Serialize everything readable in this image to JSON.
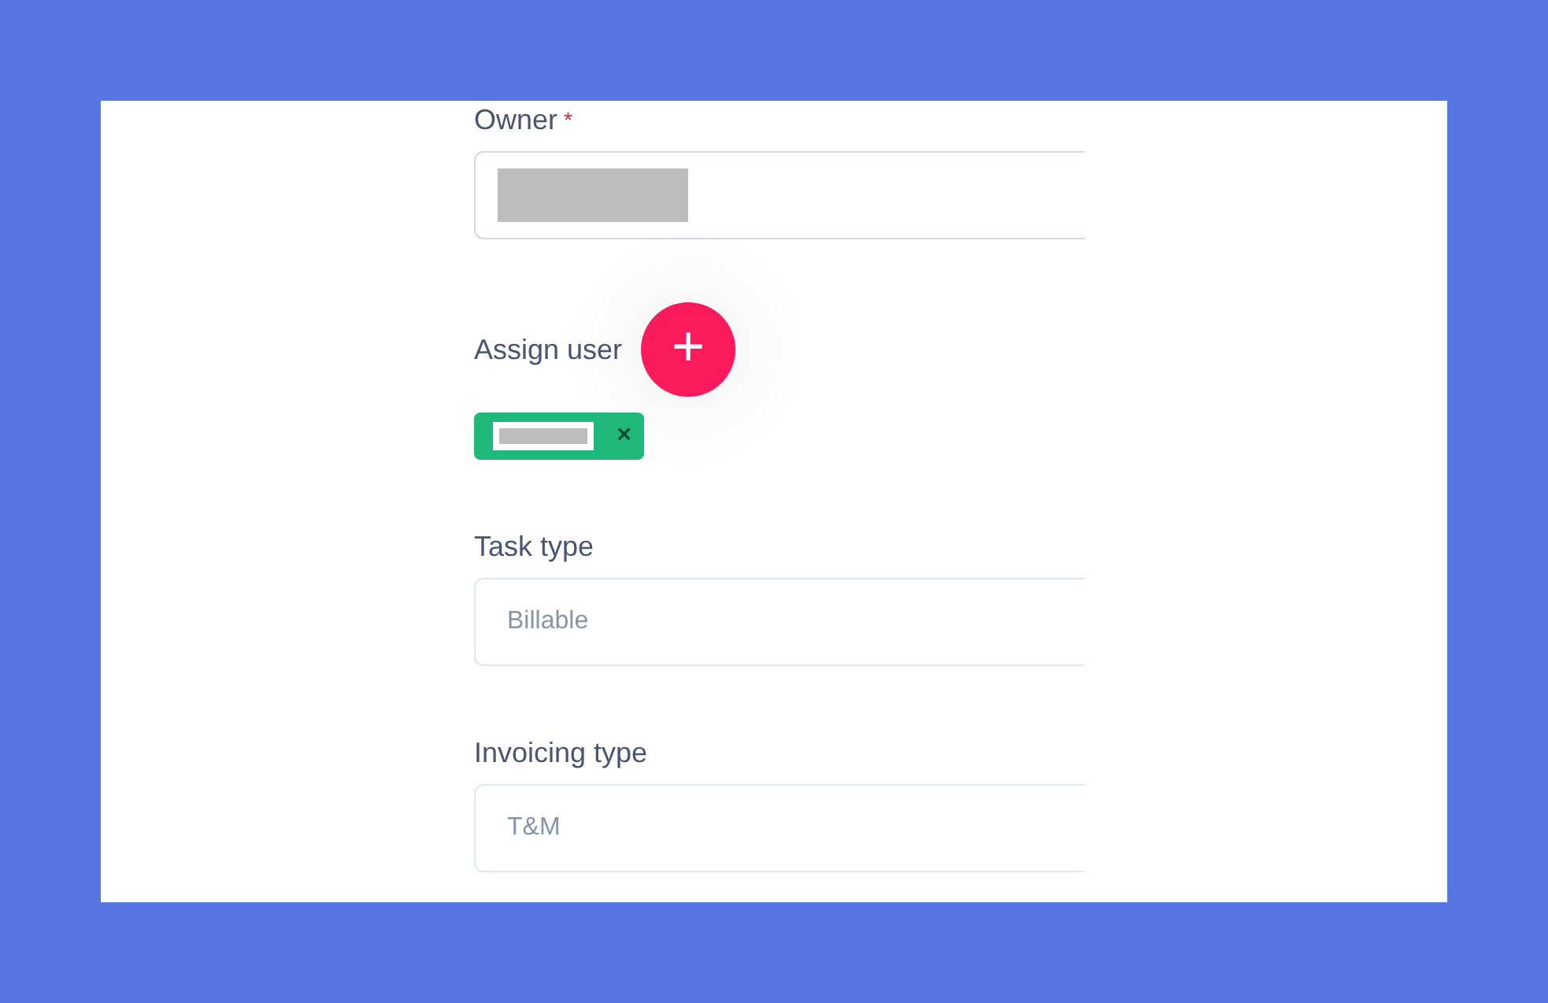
{
  "fields": [
    {
      "kind": "select",
      "label": "Owner",
      "required_mark": "*",
      "redacted": true
    },
    {
      "kind": "users",
      "label": "Assign user",
      "tags": [
        {
          "redacted": true,
          "remove": "×"
        }
      ],
      "add": "+"
    },
    {
      "kind": "select",
      "label": "Task type",
      "value": "Billable"
    },
    {
      "kind": "select",
      "label": "Invoicing type",
      "value": "T&M"
    }
  ]
}
